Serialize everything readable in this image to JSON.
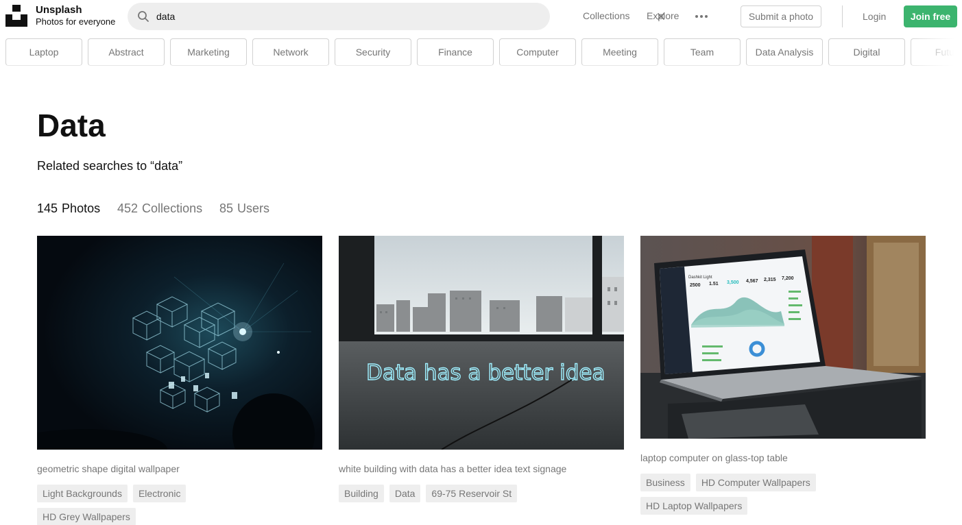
{
  "header": {
    "brand_name": "Unsplash",
    "brand_tagline": "Photos for everyone",
    "search_value": "data",
    "nav": {
      "collections": "Collections",
      "explore": "Explore"
    },
    "submit_label": "Submit a photo",
    "login_label": "Login",
    "join_label": "Join free"
  },
  "topics": [
    "Laptop",
    "Abstract",
    "Marketing",
    "Network",
    "Security",
    "Finance",
    "Computer",
    "Meeting",
    "Team",
    "Data Analysis",
    "Digital",
    "Future"
  ],
  "page": {
    "title": "Data",
    "related": "Related searches to “data”",
    "tabs": [
      {
        "count": "145",
        "label": "Photos"
      },
      {
        "count": "452",
        "label": "Collections"
      },
      {
        "count": "85",
        "label": "Users"
      }
    ]
  },
  "photos": [
    {
      "caption": "geometric shape digital wallpaper",
      "tags": [
        "Light Backgrounds",
        "Electronic",
        "HD Grey Wallpapers"
      ]
    },
    {
      "caption": "white building with data has a better idea text signage",
      "neon": "Data has a better idea",
      "tags": [
        "Building",
        "Data",
        "69-75 Reservoir St"
      ]
    },
    {
      "caption": "laptop computer on glass-top table",
      "screen": {
        "brand": "Dashkit Light",
        "stats": [
          "2500",
          "1.51",
          "3,500",
          "4,567",
          "2,315",
          "7,200"
        ]
      },
      "tags": [
        "Business",
        "HD Computer Wallpapers",
        "HD Laptop Wallpapers"
      ]
    }
  ],
  "colors": {
    "accent": "#3cb46e",
    "muted": "#767676",
    "border": "#d1d1d1",
    "chip_bg": "#eeeeee"
  }
}
